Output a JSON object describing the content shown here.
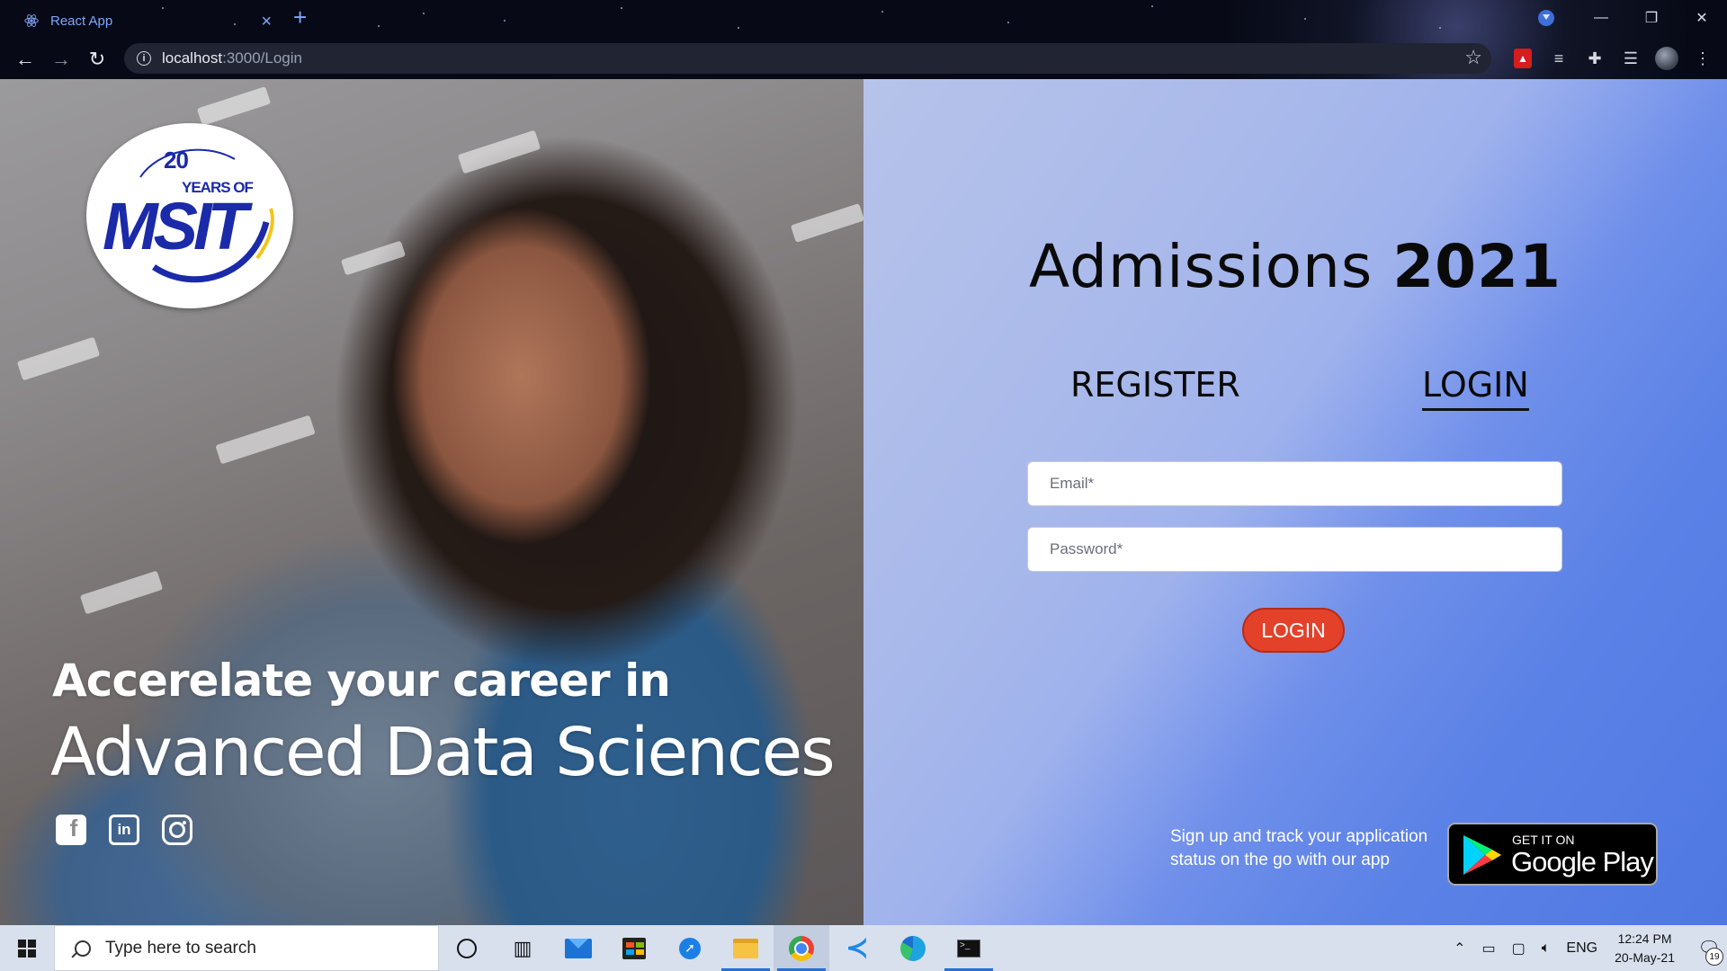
{
  "browser": {
    "tab_title": "React App",
    "url_host": "localhost",
    "url_path": ":3000/Login"
  },
  "hero": {
    "logo_number": "20",
    "logo_years": "YEARS OF",
    "logo_name": "MSIT",
    "tagline_line1": "Accerelate your career in",
    "tagline_line2": "Advanced Data Sciences",
    "social": [
      "facebook-icon",
      "linkedin-icon",
      "instagram-icon"
    ]
  },
  "panel": {
    "title_prefix": "Admissions",
    "title_year": "2021",
    "tabs": {
      "register": "REGISTER",
      "login": "LOGIN"
    },
    "email_placeholder": "Email*",
    "password_placeholder": "Password*",
    "login_button": "LOGIN",
    "app_note": "Sign up and track your application status on the go with our app",
    "store_small": "GET IT ON",
    "store_big": "Google Play"
  },
  "taskbar": {
    "search_placeholder": "Type here to search",
    "language": "ENG",
    "time": "12:24 PM",
    "date": "20-May-21",
    "notifications": "19",
    "pinned": [
      "cortana-icon",
      "task-view-icon",
      "mail-icon",
      "store-icon",
      "safari-like-icon",
      "file-explorer-icon",
      "chrome-icon",
      "vscode-icon",
      "edge-icon",
      "terminal-icon"
    ]
  },
  "colors": {
    "accent_button": "#e3412a",
    "logo_blue": "#1a2aa8",
    "panel_gradient_start": "#b6c3ea",
    "panel_gradient_end": "#4f78e2"
  }
}
